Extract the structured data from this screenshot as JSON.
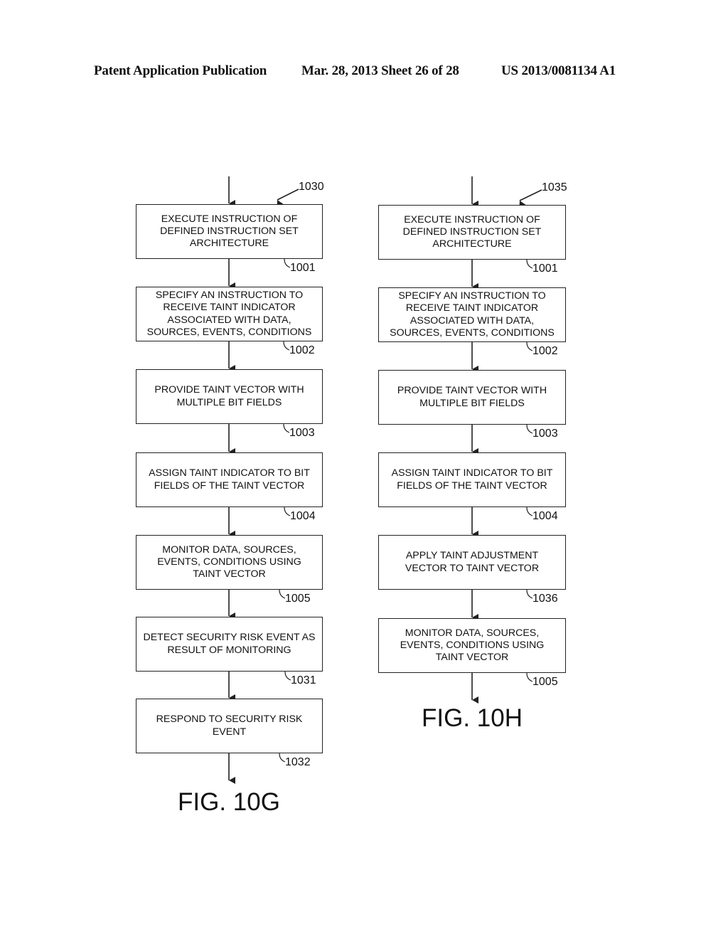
{
  "header": {
    "publication": "Patent Application Publication",
    "date_sheet": "Mar. 28, 2013  Sheet 26 of 28",
    "number": "US 2013/0081134 A1"
  },
  "fig_10g": {
    "label": "FIG. 10G",
    "ref": "1030",
    "steps": [
      {
        "text": "EXECUTE INSTRUCTION OF\nDEFINED INSTRUCTION SET\nARCHITECTURE",
        "ref": "1001"
      },
      {
        "text": "SPECIFY AN INSTRUCTION TO\nRECEIVE TAINT INDICATOR\nASSOCIATED WITH DATA,\nSOURCES, EVENTS, CONDITIONS",
        "ref": "1002"
      },
      {
        "text": "PROVIDE TAINT VECTOR WITH\nMULTIPLE BIT FIELDS",
        "ref": "1003"
      },
      {
        "text": "ASSIGN TAINT INDICATOR TO BIT\nFIELDS OF THE TAINT VECTOR",
        "ref": "1004"
      },
      {
        "text": "MONITOR DATA, SOURCES,\nEVENTS, CONDITIONS USING\nTAINT VECTOR",
        "ref": "1005"
      },
      {
        "text": "DETECT SECURITY RISK EVENT AS\nRESULT OF MONITORING",
        "ref": "1031"
      },
      {
        "text": "RESPOND TO SECURITY RISK\nEVENT",
        "ref": "1032"
      }
    ]
  },
  "fig_10h": {
    "label": "FIG. 10H",
    "ref": "1035",
    "steps": [
      {
        "text": "EXECUTE INSTRUCTION OF\nDEFINED INSTRUCTION SET\nARCHITECTURE",
        "ref": "1001"
      },
      {
        "text": "SPECIFY AN INSTRUCTION TO\nRECEIVE TAINT INDICATOR\nASSOCIATED WITH DATA,\nSOURCES, EVENTS, CONDITIONS",
        "ref": "1002"
      },
      {
        "text": "PROVIDE TAINT VECTOR WITH\nMULTIPLE BIT FIELDS",
        "ref": "1003"
      },
      {
        "text": "ASSIGN TAINT INDICATOR TO BIT\nFIELDS OF THE TAINT VECTOR",
        "ref": "1004"
      },
      {
        "text": "APPLY TAINT ADJUSTMENT\nVECTOR TO TAINT VECTOR",
        "ref": "1036"
      },
      {
        "text": "MONITOR DATA, SOURCES,\nEVENTS, CONDITIONS USING\nTAINT VECTOR",
        "ref": "1005"
      }
    ]
  }
}
